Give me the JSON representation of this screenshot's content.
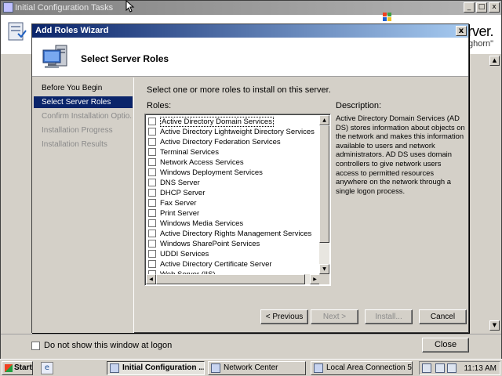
{
  "background_window": {
    "title": "Initial Configuration Tasks",
    "brand_line1": "erver.",
    "brand_line2": "nghorn\"",
    "dont_show_label": "Do not show this window at logon",
    "close_label": "Close",
    "minimize_glyph": "_",
    "maximize_glyph": "□",
    "close_glyph": "x"
  },
  "wizard": {
    "title": "Add Roles Wizard",
    "close_glyph": "x",
    "header_title": "Select Server Roles",
    "nav": [
      {
        "label": "Before You Begin",
        "state": "done"
      },
      {
        "label": "Select Server Roles",
        "state": "active"
      },
      {
        "label": "Confirm Installation Optio...",
        "state": "disabled"
      },
      {
        "label": "Installation Progress",
        "state": "disabled"
      },
      {
        "label": "Installation Results",
        "state": "disabled"
      }
    ],
    "instruction": "Select one or more roles to install on this server.",
    "roles_label": "Roles:",
    "roles": [
      "Active Directory Domain Services",
      "Active Directory Lightweight Directory Services (AD LDS)",
      "Active Directory Federation Services",
      "Terminal Services",
      "Network Access Services",
      "Windows Deployment Services",
      "DNS Server",
      "DHCP Server",
      "Fax Server",
      "Print Server",
      "Windows Media Services",
      "Active Directory Rights Management Services",
      "Windows SharePoint Services",
      "UDDI Services",
      "Active Directory Certificate Server",
      "Web Server (IIS)"
    ],
    "selected_role": "Active Directory Domain Services",
    "description_label": "Description:",
    "description_text": "Active Directory Domain Services (AD DS) stores information about objects on the network and makes this information available to users and network administrators. AD DS uses domain controllers to give network users access to permitted resources anywhere on the network through a single logon process.",
    "buttons": {
      "previous": "< Previous",
      "next": "Next >",
      "install": "Install...",
      "cancel": "Cancel"
    }
  },
  "taskbar": {
    "start_label": "Start",
    "tasks": [
      {
        "label": "Initial Configuration ...",
        "active": true
      },
      {
        "label": "Network Center",
        "active": false
      },
      {
        "label": "Local Area Connection 5 ...",
        "active": false
      }
    ],
    "clock": "11:13 AM"
  }
}
